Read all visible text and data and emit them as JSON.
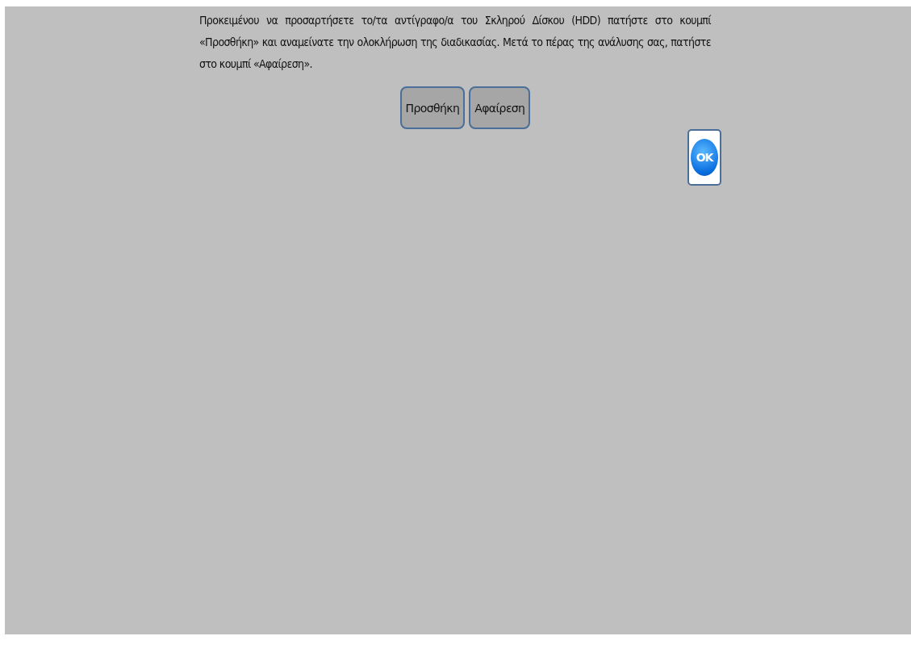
{
  "instructions": "Προκειμένου να προσαρτήσετε το/τα αντίγραφο/α του Σκληρού Δίσκου (HDD) πατήστε στο κουμπί «Προσθήκη» και αναμείνατε την ολοκλήρωση της διαδικασίας. Μετά το πέρας της ανάλυσης σας, πατήστε στο κουμπί «Αφαίρεση».",
  "buttons": [
    {
      "label": "Προσθήκη"
    },
    {
      "label": "Αφαίρεση"
    }
  ],
  "ok_button": {
    "label": "OK"
  }
}
